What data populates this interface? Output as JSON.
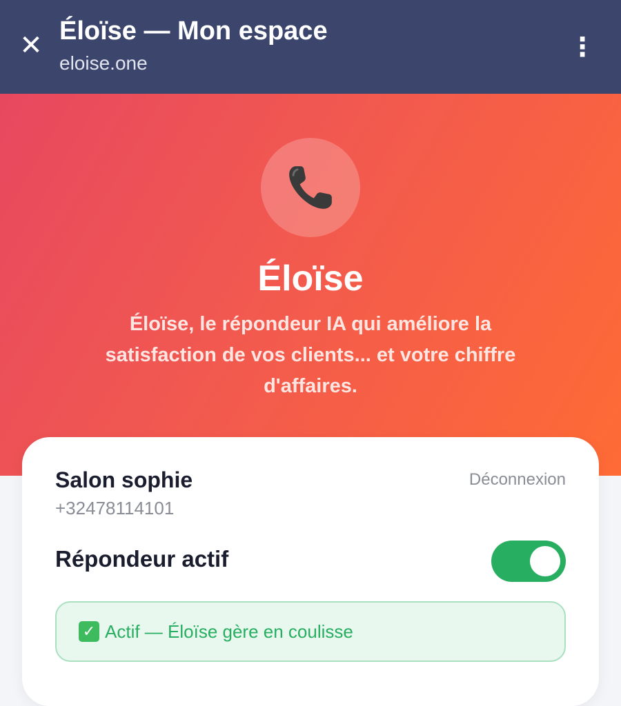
{
  "header": {
    "title": "Éloïse — Mon espace",
    "url": "eloise.one",
    "close_icon": "close-icon",
    "menu_icon": "more-vertical-icon"
  },
  "hero": {
    "icon": "telephone-icon",
    "brand_name": "Éloïse",
    "tagline": "Éloïse, le répondeur IA qui améliore la satisfaction de vos clients... et votre chiffre d'affaires."
  },
  "account": {
    "name": "Salon sophie",
    "phone": "+32478114101",
    "logout_label": "Déconnexion"
  },
  "responder": {
    "label": "Répondeur actif",
    "enabled": true,
    "status_text": "Actif — Éloïse gère en coulisse",
    "status_icon": "check-mark-icon"
  },
  "colors": {
    "header_bg": "#3c466d",
    "hero_gradient_start": "#e8485f",
    "hero_gradient_end": "#ff6b35",
    "toggle_on": "#27ae60",
    "status_text": "#27ae60",
    "status_bg": "#e8f8ee"
  }
}
